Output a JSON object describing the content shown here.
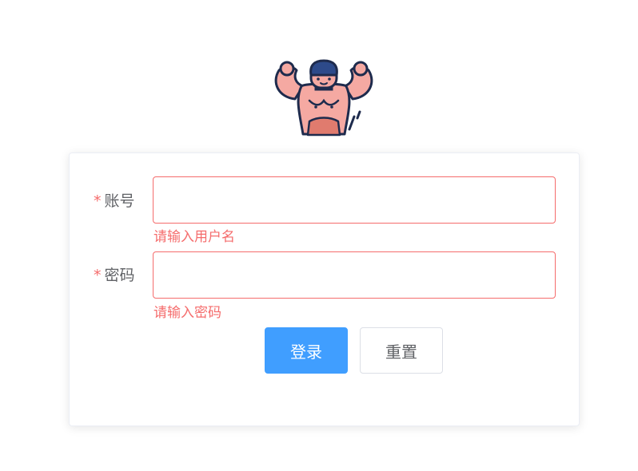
{
  "logo": {
    "icon": "muscle-man-icon"
  },
  "form": {
    "required_mark": "*",
    "username": {
      "label": "账号",
      "value": "",
      "error": "请输入用户名"
    },
    "password": {
      "label": "密码",
      "value": "",
      "error": "请输入密码"
    }
  },
  "buttons": {
    "login": "登录",
    "reset": "重置"
  },
  "colors": {
    "primary": "#409eff",
    "danger": "#f56c6c",
    "text": "#606266",
    "border": "#dcdfe6"
  }
}
